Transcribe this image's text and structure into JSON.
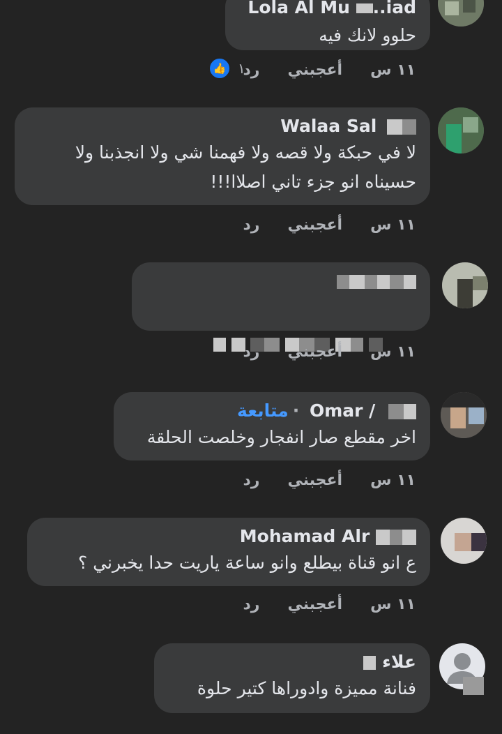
{
  "comments": [
    {
      "name": "Lola Al Mu",
      "name_tail": "..iad",
      "text": "حلوو لانك فيه",
      "time": "١١ س",
      "like_label": "أعجبني",
      "reply_label": "رد",
      "like_count": "١"
    },
    {
      "name": "Walaa Sal",
      "text": "لا في حبكة ولا قصه ولا فهمنا شي ولا انجذبنا ولا حسيناه انو جزء تاني اصلاا!!!",
      "time": "١١ س",
      "like_label": "أعجبني",
      "reply_label": "رد"
    },
    {
      "time": "١١ س",
      "like_label": "أعجبني",
      "reply_label": "رد"
    },
    {
      "name": "Omar /",
      "follow": "متابعة",
      "text": "اخر مقطع صار انفجار وخلصت الحلقة",
      "time": "١١ س",
      "like_label": "أعجبني",
      "reply_label": "رد"
    },
    {
      "name": "Mohamad Alr",
      "text": "ع انو قناة بيطلع وانو ساعة ياريت حدا يخبرني ؟",
      "time": "١١ س",
      "like_label": "أعجبني",
      "reply_label": "رد"
    },
    {
      "name": "علاء",
      "text": "فنانة مميزة وادوراها كتير حلوة"
    }
  ],
  "colors": {
    "background": "#232323",
    "bubble": "#3a3b3c",
    "text": "#e4e6eb",
    "muted": "#b0b3b8",
    "link": "#4599ff",
    "like_blue": "#1877f2"
  },
  "icons": {
    "like_reaction": "thumbs-up-icon",
    "default_avatar": "person-silhouette-icon"
  }
}
